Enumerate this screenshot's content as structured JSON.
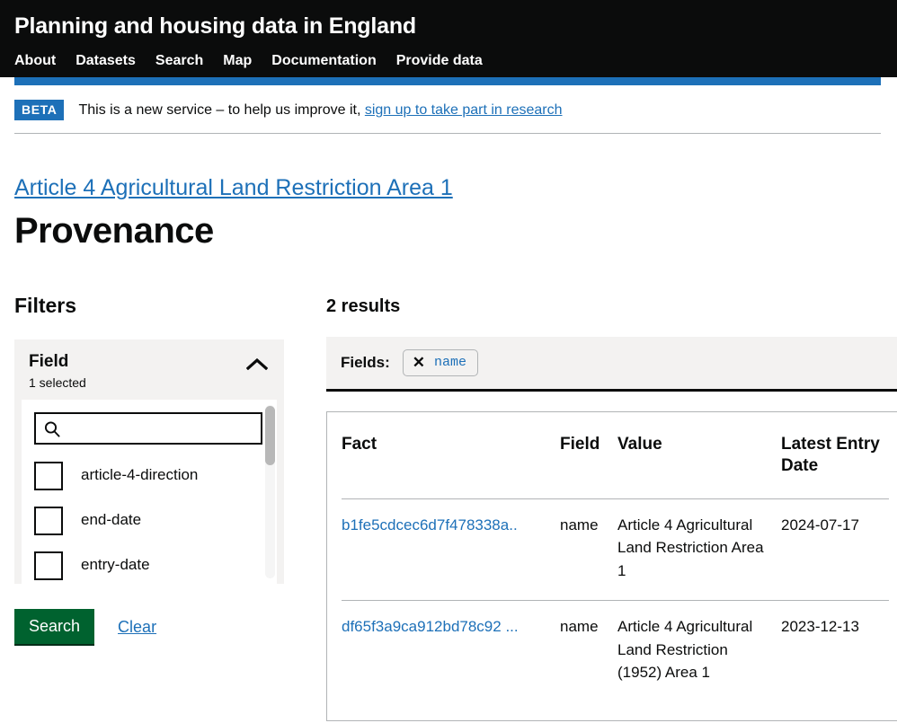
{
  "header": {
    "site_title": "Planning and housing data in England",
    "nav": [
      {
        "label": "About"
      },
      {
        "label": "Datasets"
      },
      {
        "label": "Search"
      },
      {
        "label": "Map"
      },
      {
        "label": "Documentation"
      },
      {
        "label": "Provide data"
      }
    ],
    "accent_color": "#1d70b8",
    "background_color": "#0b0c0c"
  },
  "phase_banner": {
    "tag": "BETA",
    "text": "This is a new service – to help us improve it,",
    "link": "sign up to take part in research"
  },
  "page": {
    "caption_link": "Article 4 Agricultural Land Restriction Area 1",
    "title": "Provenance"
  },
  "filters": {
    "heading": "Filters",
    "field_filter": {
      "name": "Field",
      "selected_summary": "1 selected",
      "chevron": "chevron-up-icon",
      "search_placeholder": "",
      "search_value": "",
      "search_icon": "search-icon",
      "options": [
        {
          "label": "article-4-direction",
          "checked": false
        },
        {
          "label": "end-date",
          "checked": false
        },
        {
          "label": "entry-date",
          "checked": false
        }
      ]
    },
    "search_button": "Search",
    "clear_link": "Clear",
    "search_button_color": "#00622f"
  },
  "results": {
    "count_label": "2 results",
    "fields_bar": {
      "label": "Fields:",
      "chips": [
        {
          "remove_icon": "close-icon",
          "remove_glyph": "✕",
          "text": "name"
        }
      ]
    },
    "table": {
      "columns": [
        "Fact",
        "Field",
        "Value",
        "Latest Entry Date"
      ],
      "rows": [
        {
          "fact": "b1fe5cdcec6d7f478338a..",
          "field": "name",
          "value": "Article 4 Agricultural Land Restriction Area 1",
          "latest_entry_date": "2024-07-17"
        },
        {
          "fact": "df65f3a9ca912bd78c92 ...",
          "field": "name",
          "value": "Article 4 Agricultural Land Restriction (1952) Area 1",
          "latest_entry_date": "2023-12-13"
        }
      ]
    }
  }
}
